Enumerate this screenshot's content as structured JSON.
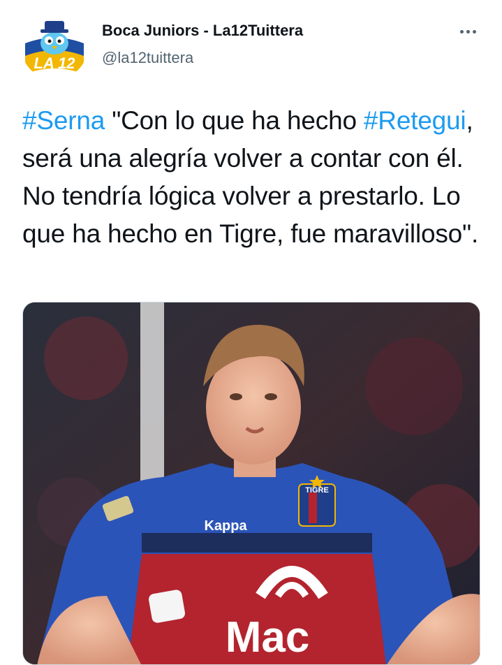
{
  "tweet": {
    "author_name": "Boca Juniors - La12Tuittera",
    "author_handle": "@la12tuittera",
    "avatar_text": "LA 12",
    "text_parts": [
      {
        "type": "hashtag",
        "text": "#Serna"
      },
      {
        "type": "text",
        "text": " \"Con lo que ha hecho "
      },
      {
        "type": "hashtag",
        "text": "#Retegui"
      },
      {
        "type": "text",
        "text": ", será una alegría volver a contar con él. No tendría lógica volver a prestarlo. Lo que ha hecho en Tigre, fue maravilloso\"."
      }
    ],
    "media": {
      "jersey_badge": "TIGRE",
      "sponsor_text": "Mac",
      "brand_text": "Kappa"
    }
  },
  "icons": {
    "more": "more-horizontal-icon"
  },
  "colors": {
    "hashtag": "#1d9bf0",
    "secondary_text": "#536471",
    "jersey_blue": "#2b54b8",
    "jersey_red": "#b3242e"
  }
}
